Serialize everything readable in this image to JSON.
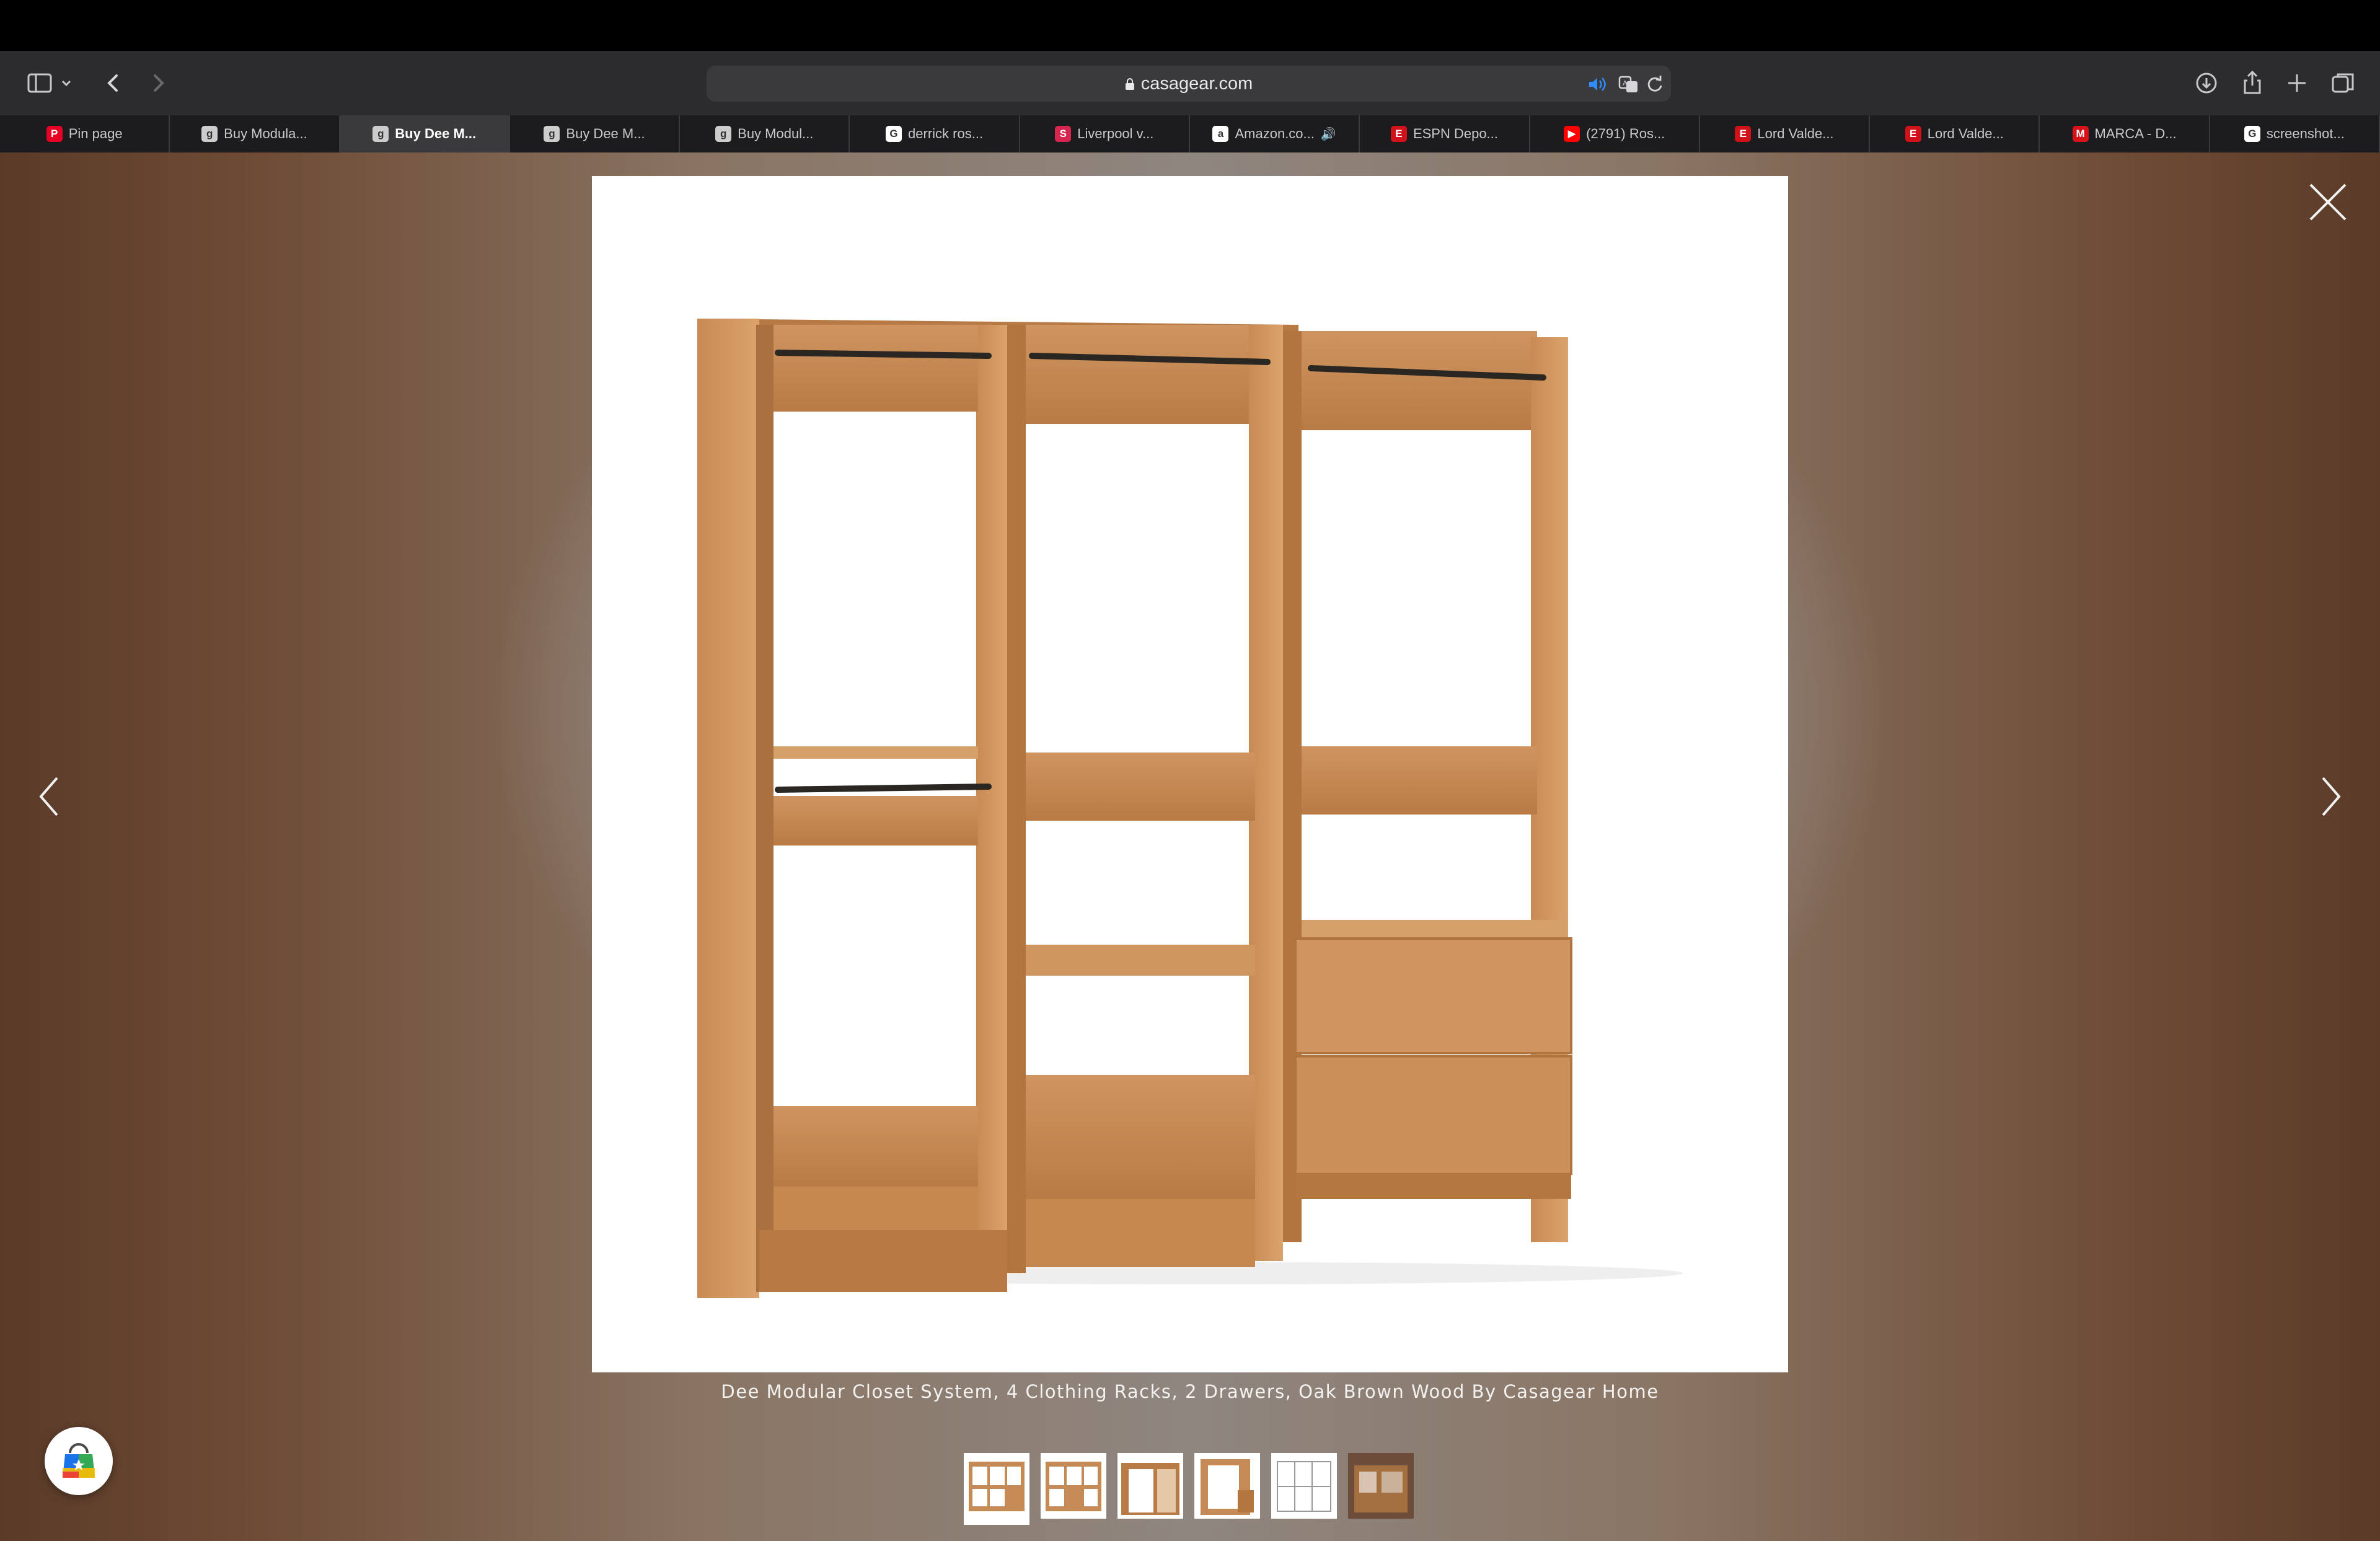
{
  "browser": {
    "url": "casagear.com",
    "tabs": [
      {
        "label": "Pin page",
        "icon": "pinterest-icon",
        "color": "#e60023",
        "glyph": "P"
      },
      {
        "label": "Buy Modula...",
        "icon": "casagear-icon",
        "color": "#cccccc",
        "glyph": "g"
      },
      {
        "label": "Buy Dee M...",
        "icon": "casagear-icon",
        "color": "#cccccc",
        "glyph": "g",
        "active": true
      },
      {
        "label": "Buy Dee M...",
        "icon": "casagear-icon",
        "color": "#cccccc",
        "glyph": "g"
      },
      {
        "label": "Buy Modul...",
        "icon": "casagear-icon",
        "color": "#cccccc",
        "glyph": "g"
      },
      {
        "label": "derrick ros...",
        "icon": "google-icon",
        "color": "#ffffff",
        "glyph": "G"
      },
      {
        "label": "Liverpool v...",
        "icon": "sofascore-icon",
        "color": "#d6254e",
        "glyph": "S"
      },
      {
        "label": "Amazon.co...",
        "icon": "amazon-icon",
        "color": "#ffffff",
        "glyph": "a",
        "speaker": "🔊"
      },
      {
        "label": "ESPN Depo...",
        "icon": "espn-icon",
        "color": "#d1121a",
        "glyph": "E"
      },
      {
        "label": "(2791) Ros...",
        "icon": "youtube-icon",
        "color": "#ff0000",
        "glyph": "▶"
      },
      {
        "label": "Lord Valde...",
        "icon": "espn-icon",
        "color": "#d1121a",
        "glyph": "E"
      },
      {
        "label": "Lord Valde...",
        "icon": "espn-icon",
        "color": "#d1121a",
        "glyph": "E"
      },
      {
        "label": "MARCA - D...",
        "icon": "marca-icon",
        "color": "#d6131b",
        "glyph": "M"
      },
      {
        "label": "screenshot...",
        "icon": "google-icon",
        "color": "#ffffff",
        "glyph": "G"
      }
    ]
  },
  "lightbox": {
    "caption": "Dee Modular Closet System, 4 Clothing Racks, 2 Drawers, Oak Brown Wood By Casagear Home",
    "thumbnail_count": 6,
    "active_thumbnail": 1
  },
  "colors": {
    "wood": "#c58a55",
    "wood_dark": "#a86f3f",
    "wood_light": "#d9a06a",
    "rod": "#2a2622"
  }
}
